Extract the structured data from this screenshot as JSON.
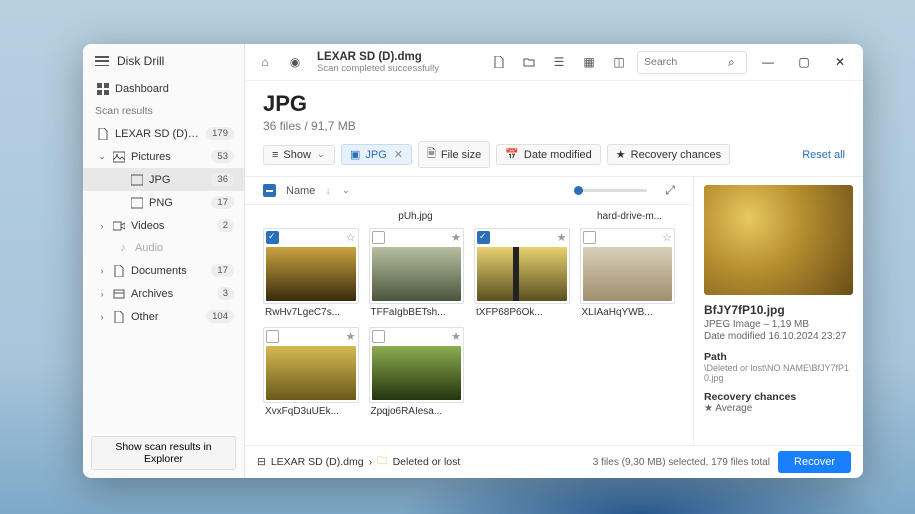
{
  "app_name": "Disk Drill",
  "sidebar": {
    "dashboard": "Dashboard",
    "section": "Scan results",
    "items": [
      {
        "label": "LEXAR SD (D).dmg",
        "badge": "179"
      },
      {
        "label": "Pictures",
        "badge": "53"
      },
      {
        "label": "JPG",
        "badge": "36"
      },
      {
        "label": "PNG",
        "badge": "17"
      },
      {
        "label": "Videos",
        "badge": "2"
      },
      {
        "label": "Audio",
        "badge": ""
      },
      {
        "label": "Documents",
        "badge": "17"
      },
      {
        "label": "Archives",
        "badge": "3"
      },
      {
        "label": "Other",
        "badge": "104"
      }
    ],
    "footer_button": "Show scan results in Explorer"
  },
  "topbar": {
    "source_name": "LEXAR SD (D).dmg",
    "source_sub": "Scan completed successfully",
    "search_placeholder": "Search"
  },
  "page": {
    "title": "JPG",
    "subtitle": "36 files / 91,7 MB"
  },
  "chips": {
    "show": "Show",
    "jpg": "JPG",
    "filesize": "File size",
    "date": "Date modified",
    "recovery": "Recovery chances",
    "reset": "Reset all"
  },
  "list_head": {
    "name": "Name"
  },
  "partial_row": {
    "a": "pUh.jpg",
    "b": "hard-drive-m..."
  },
  "files": [
    {
      "name": "RwHv7LgeC7s...",
      "checked": true
    },
    {
      "name": "TFFaIgbBETsh...",
      "checked": false
    },
    {
      "name": "tXFP68P6Ok...",
      "checked": true
    },
    {
      "name": "XLIAaHqYWB...",
      "checked": false
    },
    {
      "name": "XvxFqD3uUEk...",
      "checked": false
    },
    {
      "name": "Zpqjo6RAIesa...",
      "checked": false
    }
  ],
  "preview": {
    "name": "BfJY7fP10.jpg",
    "type_line": "JPEG Image – 1,19 MB",
    "date_line": "Date modified 16.10.2024 23:27",
    "path_label": "Path",
    "path_value": "\\Deleted or lost\\NO NAME\\BfJY7fP10.jpg",
    "recovery_label": "Recovery chances",
    "recovery_value": "Average"
  },
  "breadcrumb": {
    "a": "LEXAR SD (D).dmg",
    "b": "Deleted or lost"
  },
  "status": "3 files (9,30 MB) selected, 179 files total",
  "recover": "Recover"
}
